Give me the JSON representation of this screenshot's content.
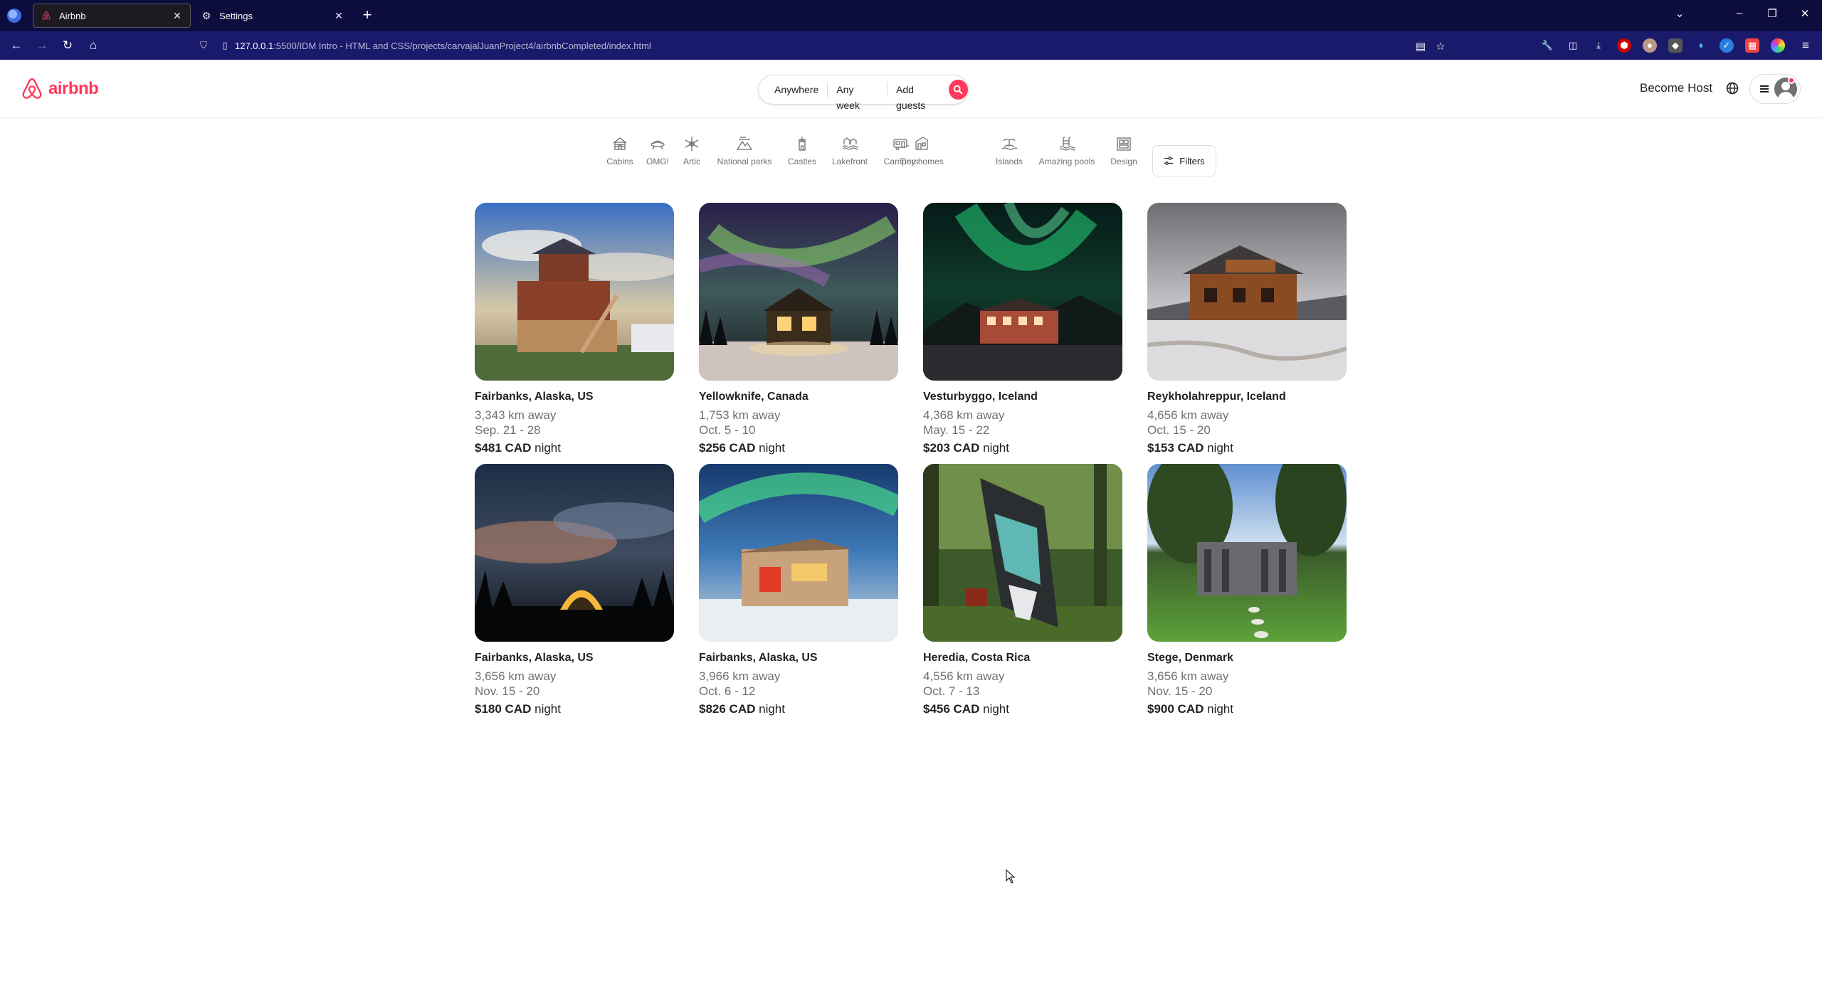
{
  "browser": {
    "tabs": [
      {
        "title": "Airbnb",
        "icon": "airbnb-icon",
        "active": true
      },
      {
        "title": "Settings",
        "icon": "gear-icon",
        "active": false
      }
    ],
    "url_host": "127.0.0.1",
    "url_path": ":5500/IDM Intro - HTML and CSS/projects/carvajalJuanProject4/airbnbCompleted/index.html"
  },
  "header": {
    "logo_text": "airbnb",
    "search": {
      "where": "Anywhere",
      "when": "Any week",
      "who": "Add guests"
    },
    "become_host": "Become Host"
  },
  "categories": [
    {
      "label": "Cabins",
      "icon": "cabin-icon"
    },
    {
      "label": "OMG!",
      "icon": "ufo-icon"
    },
    {
      "label": "Artic",
      "icon": "snowflake-icon"
    },
    {
      "label": "National parks",
      "icon": "park-icon"
    },
    {
      "label": "Castles",
      "icon": "castle-icon"
    },
    {
      "label": "Lakefront",
      "icon": "lake-icon"
    },
    {
      "label": "Campers",
      "icon": "camper-icon"
    },
    {
      "label": "Tiny homes",
      "icon": "tiny-home-icon"
    },
    {
      "label": "Islands",
      "icon": "island-icon"
    },
    {
      "label": "Amazing pools",
      "icon": "pool-icon"
    },
    {
      "label": "Design",
      "icon": "design-icon"
    }
  ],
  "filters_label": "Filters",
  "listings": [
    {
      "location": "Fairbanks, Alaska, US",
      "distance": "3,343 km away",
      "dates": "Sep. 21 - 28",
      "price": "$481 CAD",
      "unit": "night"
    },
    {
      "location": "Yellowknife, Canada",
      "distance": "1,753 km away",
      "dates": "Oct. 5 - 10",
      "price": "$256 CAD",
      "unit": "night"
    },
    {
      "location": "Vesturbyggo, Iceland",
      "distance": "4,368 km away",
      "dates": "May. 15 - 22",
      "price": "$203 CAD",
      "unit": "night"
    },
    {
      "location": "Reykholahreppur, Iceland",
      "distance": "4,656 km away",
      "dates": "Oct. 15 - 20",
      "price": "$153 CAD",
      "unit": "night"
    },
    {
      "location": "Fairbanks, Alaska, US",
      "distance": "3,656 km away",
      "dates": "Nov. 15 - 20",
      "price": "$180 CAD",
      "unit": "night"
    },
    {
      "location": "Fairbanks, Alaska, US",
      "distance": "3,966 km away",
      "dates": "Oct. 6 - 12",
      "price": "$826 CAD",
      "unit": "night"
    },
    {
      "location": "Heredia, Costa Rica",
      "distance": "4,556 km away",
      "dates": "Oct. 7 - 13",
      "price": "$456 CAD",
      "unit": "night"
    },
    {
      "location": "Stege, Denmark",
      "distance": "3,656 km away",
      "dates": "Nov. 15 - 20",
      "price": "$900 CAD",
      "unit": "night"
    }
  ],
  "colors": {
    "brand": "#ff385c",
    "chrome_tabbar": "#0c0c3d",
    "chrome_navbar": "#1a1a6d",
    "muted_text": "#717171"
  }
}
